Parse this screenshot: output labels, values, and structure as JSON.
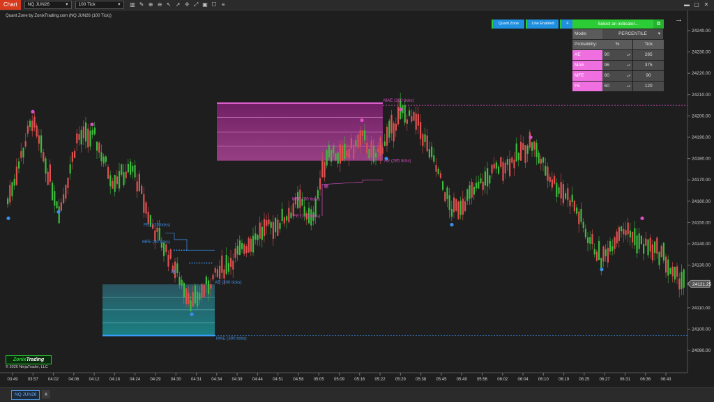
{
  "toolbar": {
    "chart_tab": "Chart",
    "instrument": "NQ JUN26",
    "interval": "100 Tick",
    "icons": [
      "bar-chart-icon",
      "pencil-icon",
      "zoom-in-icon",
      "zoom-out-icon",
      "cursor-icon",
      "arrow-icon",
      "crosshair-icon",
      "fit-icon",
      "fullscreen-icon",
      "data-box-icon",
      "list-icon"
    ],
    "window_controls": [
      "minimize-icon",
      "maximize-icon",
      "close-icon"
    ]
  },
  "chart_title": "Quant Zone by ZonixTrading.com (NQ JUN26 (100 Tick))",
  "quant_buttons": [
    "Quant Zone",
    "Line Enabled",
    "F"
  ],
  "panel": {
    "select_label": "Select an indicator...",
    "mode_label": "Mode:",
    "mode_value": "PERCENTILE",
    "prob_label": "Probability:",
    "col_pct": "%",
    "col_tick": "Tick",
    "rows": [
      {
        "name": "AE",
        "pct": "90",
        "tick": "285"
      },
      {
        "name": "MAE",
        "pct": "96",
        "tick": "375"
      },
      {
        "name": "MFE",
        "pct": "80",
        "tick": "90"
      },
      {
        "name": "FE",
        "pct": "60",
        "tick": "120"
      }
    ]
  },
  "annotations": {
    "mae_top": "MAE (390 ticks)",
    "ae_top": "AE (285 ticks)",
    "mfe_top": "MFE (90 ticks)",
    "fe_top": "FE (120 ticks)",
    "fe_bot": "FE (120 ticks)",
    "mfe_bot": "MFE (90 ticks)",
    "ae_bot": "AE (300 ticks)",
    "mae_bot": "MAE (390 ticks)"
  },
  "price_axis": [
    "24240.00",
    "24230.00",
    "24220.00",
    "24210.00",
    "24200.00",
    "24190.00",
    "24180.00",
    "24170.00",
    "24160.00",
    "24150.00",
    "24140.00",
    "24130.00",
    "24110.00",
    "24100.00",
    "24090.00"
  ],
  "current_price": "24121.25",
  "time_axis": [
    "03:49",
    "03:57",
    "04:02",
    "04:06",
    "04:12",
    "04:18",
    "04:24",
    "04:29",
    "04:30",
    "04:31",
    "04:34",
    "04:39",
    "04:44",
    "04:51",
    "04:58",
    "05:05",
    "05:09",
    "05:16",
    "05:22",
    "05:29",
    "05:38",
    "05:45",
    "05:49",
    "05:56",
    "06:02",
    "06:04",
    "06:10",
    "06:19",
    "06:25",
    "06:27",
    "06:31",
    "06:36",
    "06:43"
  ],
  "logo": {
    "part1": "Zonix",
    "part2": "Trading"
  },
  "copyright": "© 2026 NinjaTrader, LLC",
  "bottom_tab": "NQ JUN26",
  "add_tab": "+",
  "colors": {
    "up": "#3dbb3d",
    "down": "#e05050",
    "pink": "#d94fc4",
    "blue": "#3a8fe8",
    "green": "#2bcc35"
  }
}
